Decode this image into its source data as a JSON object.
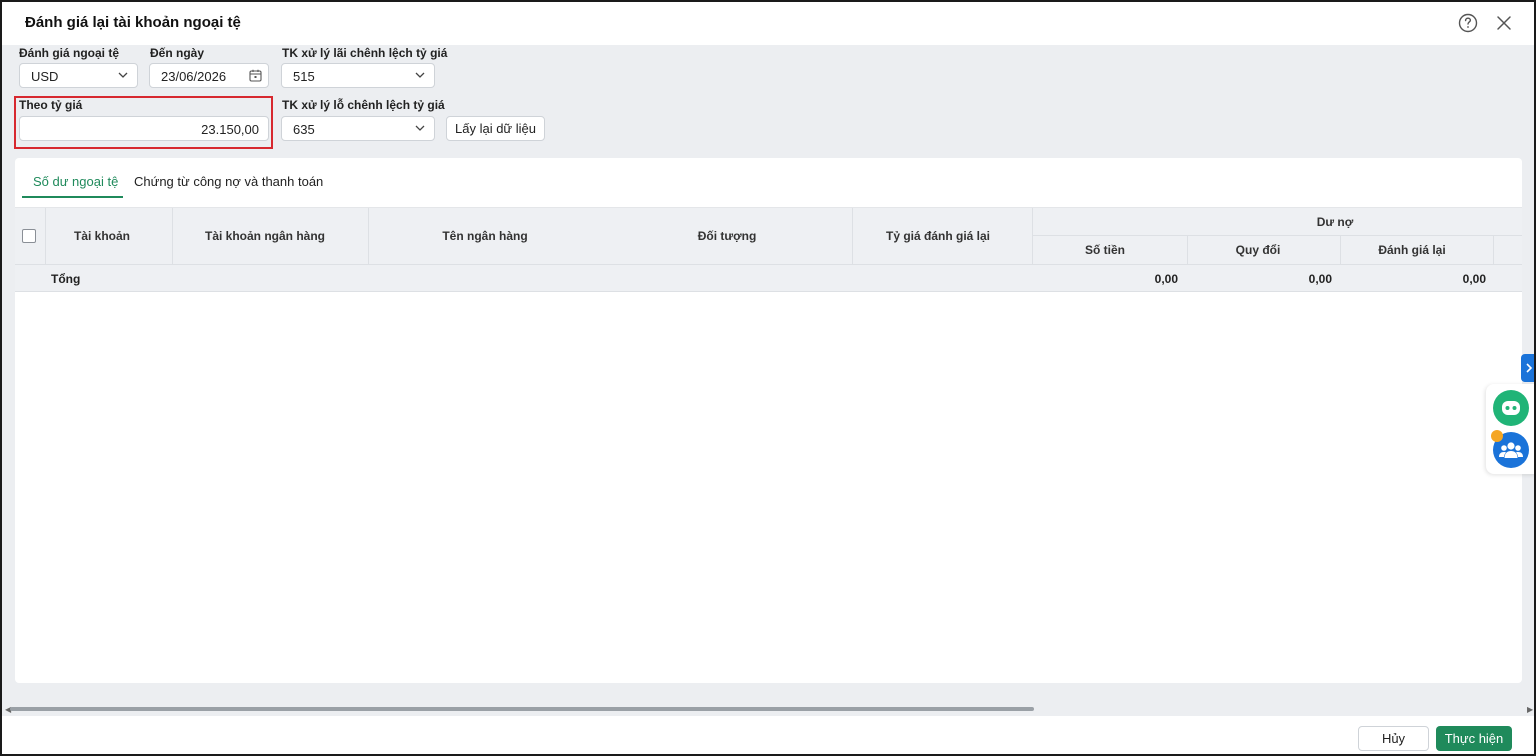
{
  "dialog": {
    "title": "Đánh giá lại tài khoản ngoại tệ"
  },
  "filters": {
    "currency_label": "Đánh giá ngoại tệ",
    "currency_value": "USD",
    "date_label": "Đến ngày",
    "date_value": "23/06/2026",
    "gain_account_label": "TK xử lý lãi chênh lệch tỷ giá",
    "gain_account_value": "515",
    "rate_label": "Theo tỷ giá",
    "rate_value": "23.150,00",
    "loss_account_label": "TK xử lý lỗ chênh lệch tỷ giá",
    "loss_account_value": "635",
    "reload_button": "Lấy lại dữ liệu"
  },
  "tabs": [
    {
      "label": "Số dư ngoại tệ",
      "active": true
    },
    {
      "label": "Chứng từ công nợ và thanh toán",
      "active": false
    }
  ],
  "table": {
    "columns": {
      "account": "Tài khoản",
      "bank_account": "Tài khoản ngân hàng",
      "bank_name": "Tên ngân hàng",
      "object": "Đối tượng",
      "revaluation_rate": "Tỷ giá đánh giá lại",
      "debit_group": "Dư nợ",
      "amount": "Số tiền",
      "converted": "Quy đổi",
      "revalued": "Đánh giá lại"
    },
    "total": {
      "label": "Tổng",
      "amount": "0,00",
      "converted": "0,00",
      "revalued": "0,00"
    }
  },
  "footer": {
    "cancel_button": "Hủy",
    "run_button": "Thực hiện"
  },
  "colors": {
    "accent": "#1f8a5b",
    "highlight": "#d7282f",
    "side_blue": "#1a73d9"
  }
}
